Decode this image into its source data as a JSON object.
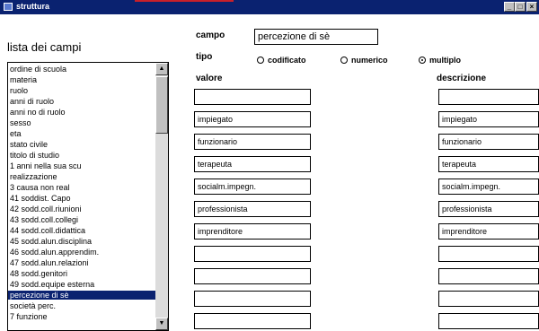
{
  "window": {
    "title": "struttura",
    "controls": [
      "_",
      "□",
      "×"
    ]
  },
  "list_heading": "lista dei campi",
  "list_items": [
    "ordine di scuola",
    "materia",
    "ruolo",
    "anni di ruolo",
    "anni no di ruolo",
    "sesso",
    "eta",
    "stato civile",
    "titolo di studio",
    "1 anni nella sua scu",
    "realizzazione",
    "3 causa non real",
    "41 soddist. Capo",
    "42 sodd.coll.riunioni",
    "43 sodd.coll.collegi",
    "44 sodd.coll.didattica",
    "45 sodd.alun.disciplina",
    "46 sodd.alun.apprendim.",
    "47 sodd.alun.relazioni",
    "48 sodd.genitori",
    "49 sodd.equipe esterna",
    "percezione di sè",
    "società perc.",
    "7 funzione"
  ],
  "selected_index": 21,
  "campo_label": "campo",
  "campo_value": "percezione di sè",
  "tipo_label": "tipo",
  "tipo_options": [
    "codificato",
    "numerico",
    "multiplo"
  ],
  "tipo_selected": 2,
  "valore_label": "valore",
  "descrizione_label": "descrizione",
  "valori": [
    "",
    "impiegato",
    "funzionario",
    "terapeuta",
    "socialm.impegn.",
    "professionista",
    "imprenditore",
    "",
    "",
    "",
    ""
  ],
  "descrizioni": [
    "",
    "impiegato",
    "funzionario",
    "terapeuta",
    "socialm.impegn.",
    "professionista",
    "imprenditore",
    "",
    "",
    "",
    ""
  ]
}
